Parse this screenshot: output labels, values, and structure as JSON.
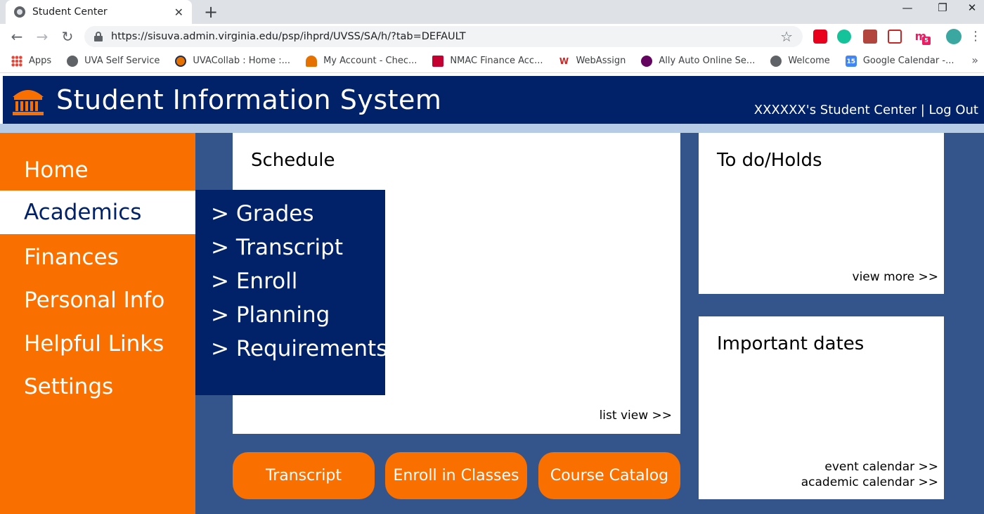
{
  "browser": {
    "tab_title": "Student Center",
    "tab_close": "✕",
    "new_tab": "+",
    "url": "https://sisuva.admin.virginia.edu/psp/ihprd/UVSS/SA/h/?tab=DEFAULT",
    "window_minimize": "—",
    "window_restore": "❐",
    "window_close": "✕",
    "back": "←",
    "forward": "→",
    "reload": "↻",
    "star": "☆",
    "bookmarks": [
      {
        "label": "Apps",
        "icon": "apps-grid-icon",
        "color": "#ea4335"
      },
      {
        "label": "UVA Self Service",
        "icon": "globe-icon",
        "color": "#5f6368"
      },
      {
        "label": "UVACollab : Home :...",
        "icon": "uvacollab-icon",
        "color": "#e57200"
      },
      {
        "label": "My Account - Chec...",
        "icon": "bank-icon",
        "color": "#e57200"
      },
      {
        "label": "NMAC Finance Acc...",
        "icon": "nissan-icon",
        "color": "#c3002f"
      },
      {
        "label": "WebAssign",
        "icon": "webassign-icon",
        "color": "#c62828"
      },
      {
        "label": "Ally Auto Online Se...",
        "icon": "ally-icon",
        "color": "#650360"
      },
      {
        "label": "Welcome",
        "icon": "globe-icon",
        "color": "#5f6368"
      },
      {
        "label": "Google Calendar -...",
        "icon": "calendar-icon",
        "color": "#4285f4"
      }
    ],
    "bookmarks_more": "»",
    "calendar_badge": "15",
    "ext_badge": "5"
  },
  "header": {
    "title": "Student Information System",
    "user_center": "XXXXXX's Student Center",
    "separator": " | ",
    "logout": "Log Out"
  },
  "sidebar": {
    "items": [
      {
        "label": "Home",
        "active": false
      },
      {
        "label": "Academics",
        "active": true
      },
      {
        "label": "Finances",
        "active": false
      },
      {
        "label": "Personal Info",
        "active": false
      },
      {
        "label": "Helpful Links",
        "active": false
      },
      {
        "label": "Settings",
        "active": false
      }
    ]
  },
  "flyout": {
    "items": [
      "> Grades",
      "> Transcript",
      "> Enroll",
      "> Planning",
      "> Requirements"
    ]
  },
  "schedule": {
    "title": "Schedule",
    "link": "list view >>"
  },
  "todo": {
    "title": "To do/Holds",
    "link": "view more >>"
  },
  "dates": {
    "title": "Important dates",
    "link_event": "event calendar >>",
    "link_academic": "academic calendar >>"
  },
  "buttons": {
    "transcript": "Transcript",
    "enroll": "Enroll in Classes",
    "catalog": "Course Catalog"
  },
  "colors": {
    "navy": "#012169",
    "orange": "#f96f00",
    "panel_blue": "#33558b",
    "accent_light_blue": "#b6cbe6"
  }
}
